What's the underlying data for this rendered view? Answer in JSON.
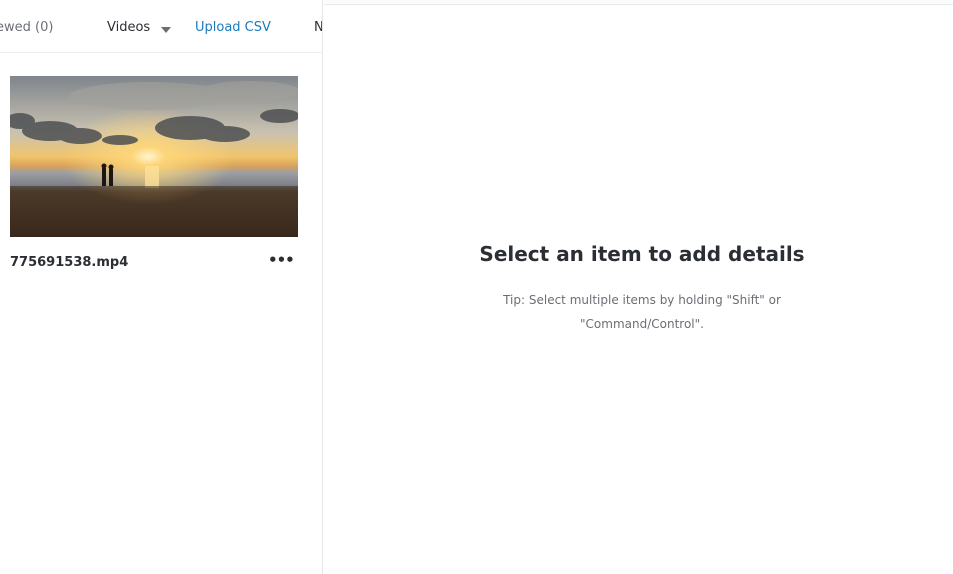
{
  "toolbar": {
    "reviewed_label": "ewed (0)",
    "videos_label": "Videos",
    "upload_label": "Upload CSV",
    "next_label": "N"
  },
  "items": [
    {
      "filename": "775691538.mp4",
      "more_label": "•••",
      "thumbnail": "beach-sunset-thumbnail"
    }
  ],
  "details": {
    "empty_title": "Select an item to add details",
    "tip": "Tip: Select multiple items by holding \"Shift\" or \"Command/Control\"."
  },
  "colors": {
    "link": "#1a7bbf",
    "text": "#2b2e33",
    "muted": "#6b6f75",
    "border": "#e4e6e8"
  }
}
